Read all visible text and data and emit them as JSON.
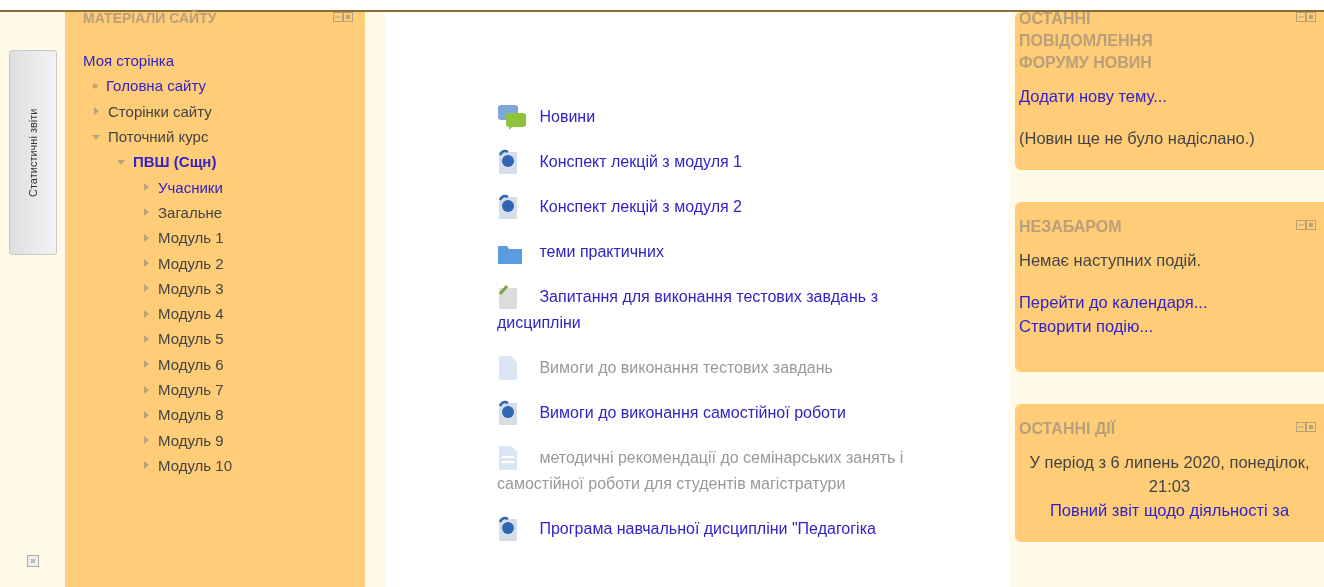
{
  "side_tab": {
    "label": "Статистичні звіти"
  },
  "navigation": {
    "title": "МАТЕРІАЛИ САЙТУ",
    "items": [
      {
        "label": "Моя сторінка",
        "kind": "plain",
        "link": true,
        "current": false,
        "children": [
          {
            "label": "Головна сайту",
            "kind": "leaf",
            "link": true,
            "current": false
          },
          {
            "label": "Сторінки сайту",
            "kind": "branch",
            "expanded": false,
            "link": false,
            "current": false
          },
          {
            "label": "Поточний курс",
            "kind": "branch",
            "expanded": true,
            "link": false,
            "current": false,
            "children": [
              {
                "label": "ПВШ (Сщн)",
                "kind": "branch",
                "expanded": true,
                "link": true,
                "current": true,
                "children": [
                  {
                    "label": "Учасники",
                    "kind": "branch",
                    "expanded": false,
                    "link": true,
                    "current": false
                  },
                  {
                    "label": "Загальне",
                    "kind": "branch",
                    "expanded": false,
                    "link": false,
                    "current": false
                  },
                  {
                    "label": "Модуль 1",
                    "kind": "branch",
                    "expanded": false,
                    "link": false,
                    "current": false
                  },
                  {
                    "label": "Модуль 2",
                    "kind": "branch",
                    "expanded": false,
                    "link": false,
                    "current": false
                  },
                  {
                    "label": "Модуль 3",
                    "kind": "branch",
                    "expanded": false,
                    "link": false,
                    "current": false
                  },
                  {
                    "label": "Модуль 4",
                    "kind": "branch",
                    "expanded": false,
                    "link": false,
                    "current": false
                  },
                  {
                    "label": "Модуль 5",
                    "kind": "branch",
                    "expanded": false,
                    "link": false,
                    "current": false
                  },
                  {
                    "label": "Модуль 6",
                    "kind": "branch",
                    "expanded": false,
                    "link": false,
                    "current": false
                  },
                  {
                    "label": "Модуль 7",
                    "kind": "branch",
                    "expanded": false,
                    "link": false,
                    "current": false
                  },
                  {
                    "label": "Модуль 8",
                    "kind": "branch",
                    "expanded": false,
                    "link": false,
                    "current": false
                  },
                  {
                    "label": "Модуль 9",
                    "kind": "branch",
                    "expanded": false,
                    "link": false,
                    "current": false
                  },
                  {
                    "label": "Модуль 10",
                    "kind": "branch",
                    "expanded": false,
                    "link": false,
                    "current": false
                  }
                ]
              }
            ]
          }
        ]
      }
    ]
  },
  "activities": [
    {
      "kind": "forum",
      "title": "Новини",
      "hidden": false
    },
    {
      "kind": "resource",
      "title": "Конспект лекцій з модуля 1",
      "hidden": false
    },
    {
      "kind": "resource",
      "title": "Конспект лекцій з модуля 2",
      "hidden": false
    },
    {
      "kind": "folder",
      "title": "теми практичних",
      "hidden": false
    },
    {
      "kind": "quiz",
      "title": "Запитання для виконання тестових завдань з дисципліни",
      "hidden": false
    },
    {
      "kind": "page",
      "title": "Вимоги до виконання тестових завдань",
      "hidden": true
    },
    {
      "kind": "resource",
      "title": "Вимоги до виконання самостійної роботи",
      "hidden": false
    },
    {
      "kind": "file",
      "title": "методичні рекомендації до семінарських занять і самостійної роботи для студентів магістратури",
      "hidden": true
    },
    {
      "kind": "resource",
      "title": "Програма навчальної дисципліни \"Педагогіка",
      "hidden": false
    }
  ],
  "blocks": [
    {
      "kind": "list",
      "title": "ОСТАННІ ПОВІДОМЛЕННЯ ФОРУМУ НОВИН",
      "paragraphs": [
        [
          {
            "kind": "link",
            "text": "Додати нову тему..."
          }
        ],
        [
          {
            "kind": "text",
            "text": "(Новин ще не було надіслано.)"
          }
        ]
      ]
    },
    {
      "kind": "list",
      "title": "НЕЗАБАРОМ",
      "paragraphs": [
        [
          {
            "kind": "text",
            "text": "Немає наступних подій."
          }
        ],
        [
          {
            "kind": "link",
            "text": "Перейти до календаря..."
          },
          {
            "kind": "link",
            "text": "Створити подію..."
          }
        ]
      ]
    },
    {
      "kind": "summary",
      "title": "ОСТАННІ ДІЇ",
      "paragraphs": [
        [
          {
            "kind": "text",
            "text": "У період з 6 липень 2020, понеділок, 21:03"
          },
          {
            "kind": "link",
            "text": "Повний звіт щодо діяльності за"
          }
        ]
      ]
    }
  ]
}
